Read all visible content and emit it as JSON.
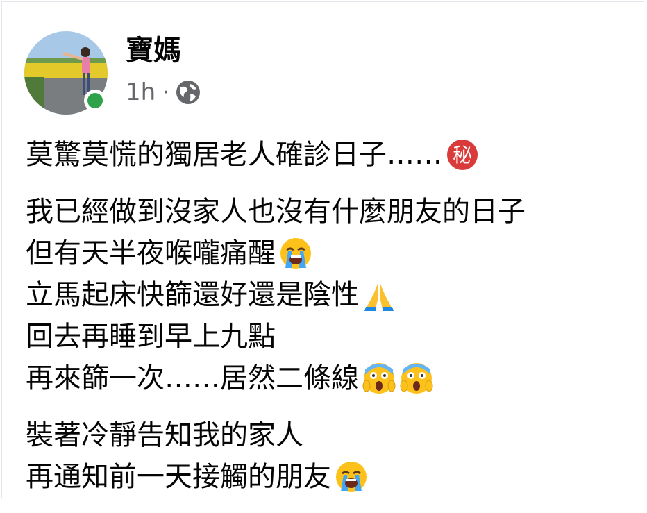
{
  "post": {
    "author": "寶媽",
    "timestamp": "1h",
    "separator": "·",
    "privacy_icon": "globe-icon",
    "online": true,
    "colors": {
      "online": "#31a24c",
      "meta": "#65676b",
      "text": "#050505"
    }
  },
  "body": {
    "line1": "莫驚莫慌的獨居老人確診日子……",
    "line2": "我已經做到沒家人也沒有什麼朋友的日子",
    "line3": "但有天半夜喉嚨痛醒",
    "line4": "立馬起床快篩還好還是陰性",
    "line5": "回去再睡到早上九點",
    "line6": "再來篩一次……居然二條線",
    "line7": "裝著冷靜告知我的家人",
    "line8": "再通知前一天接觸的朋友"
  },
  "emojis": {
    "secret": "secret-emoji",
    "loudly_crying": "loudly-crying-face-emoji",
    "folded_hands": "folded-hands-emoji",
    "screaming": "face-screaming-in-fear-emoji",
    "secret_glyph": "秘"
  }
}
